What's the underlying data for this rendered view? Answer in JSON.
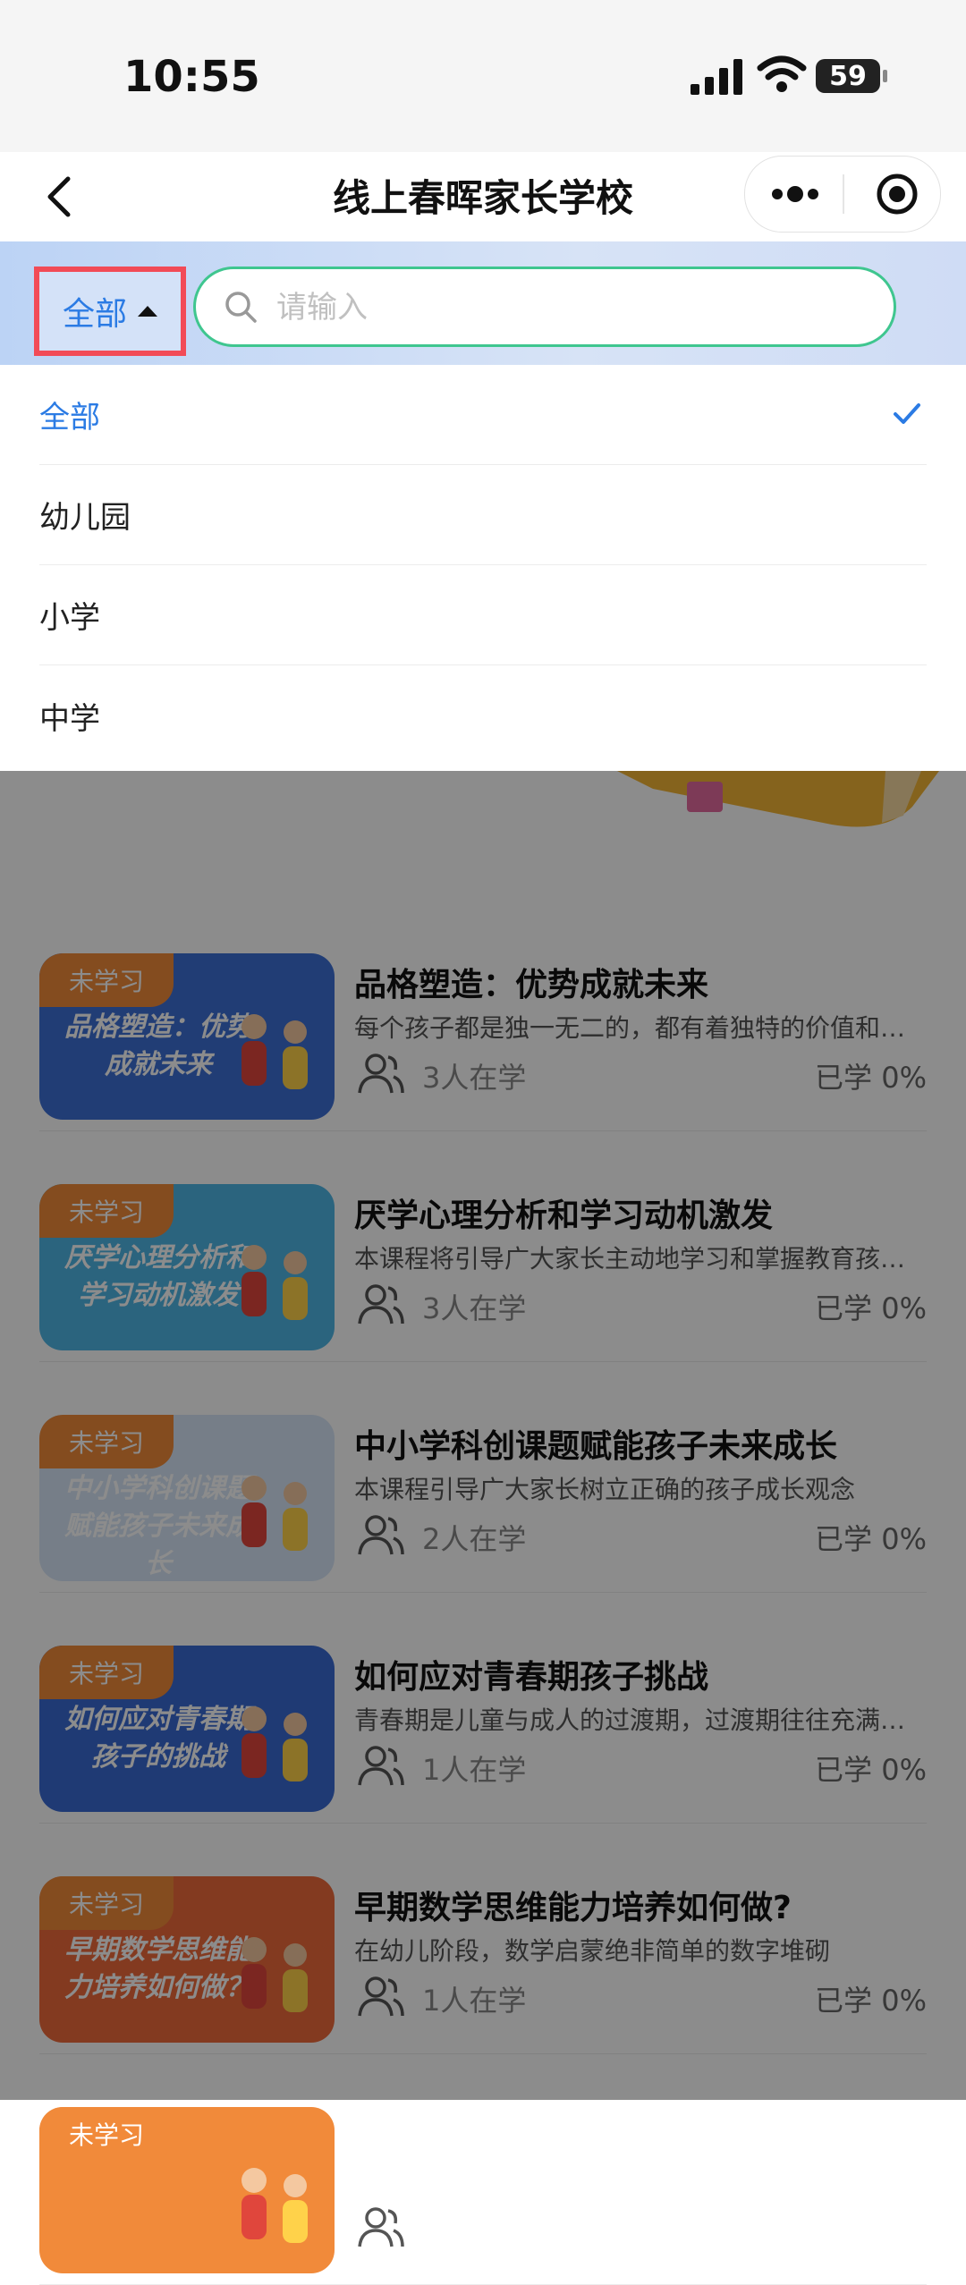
{
  "status_bar": {
    "time": "10:55",
    "battery": "59"
  },
  "nav": {
    "title": "线上春晖家长学校"
  },
  "filter": {
    "selected": "全部",
    "search_placeholder": "请输入",
    "options": [
      {
        "label": "全部",
        "active": true
      },
      {
        "label": "幼儿园",
        "active": false
      },
      {
        "label": "小学",
        "active": false
      },
      {
        "label": "中学",
        "active": false
      }
    ]
  },
  "courses": [
    {
      "tag": "未学习",
      "thumb_text": "品格塑造：优势成就未来",
      "thumb_color": "#3d6fd6",
      "title": "品格塑造：优势成就未来",
      "desc": "每个孩子都是独一无二的，都有着独特的价值和优势",
      "learners": "3人在学",
      "progress": "已学 0%"
    },
    {
      "tag": "未学习",
      "thumb_text": "厌学心理分析和学习动机激发",
      "thumb_color": "#4fb6e6",
      "title": "厌学心理分析和学习动机激发",
      "desc": "本课程将引导广大家长主动地学习和掌握教育孩子的方法",
      "learners": "3人在学",
      "progress": "已学 0%"
    },
    {
      "tag": "未学习",
      "thumb_text": "中小学科创课题赋能孩子未来成长",
      "thumb_color": "#d7e6f7",
      "title": "中小学科创课题赋能孩子未来成长",
      "desc": "本课程引导广大家长树立正确的孩子成长观念",
      "learners": "2人在学",
      "progress": "已学 0%"
    },
    {
      "tag": "未学习",
      "thumb_text": "如何应对青春期孩子的挑战",
      "thumb_color": "#3a6ad4",
      "title": "如何应对青春期孩子挑战",
      "desc": "青春期是儿童与成人的过渡期，过渡期往往充满挑战",
      "learners": "1人在学",
      "progress": "已学 0%"
    },
    {
      "tag": "未学习",
      "thumb_text": "早期数学思维能力培养如何做？",
      "thumb_color": "#ef6b3b",
      "title": "早期数学思维能力培养如何做?",
      "desc": "在幼儿阶段，数学启蒙绝非简单的数字堆砌",
      "learners": "1人在学",
      "progress": "已学 0%"
    },
    {
      "tag": "未学习",
      "thumb_text": "",
      "thumb_color": "#f18a3a",
      "title": "",
      "desc": "",
      "learners": "",
      "progress": ""
    }
  ]
}
